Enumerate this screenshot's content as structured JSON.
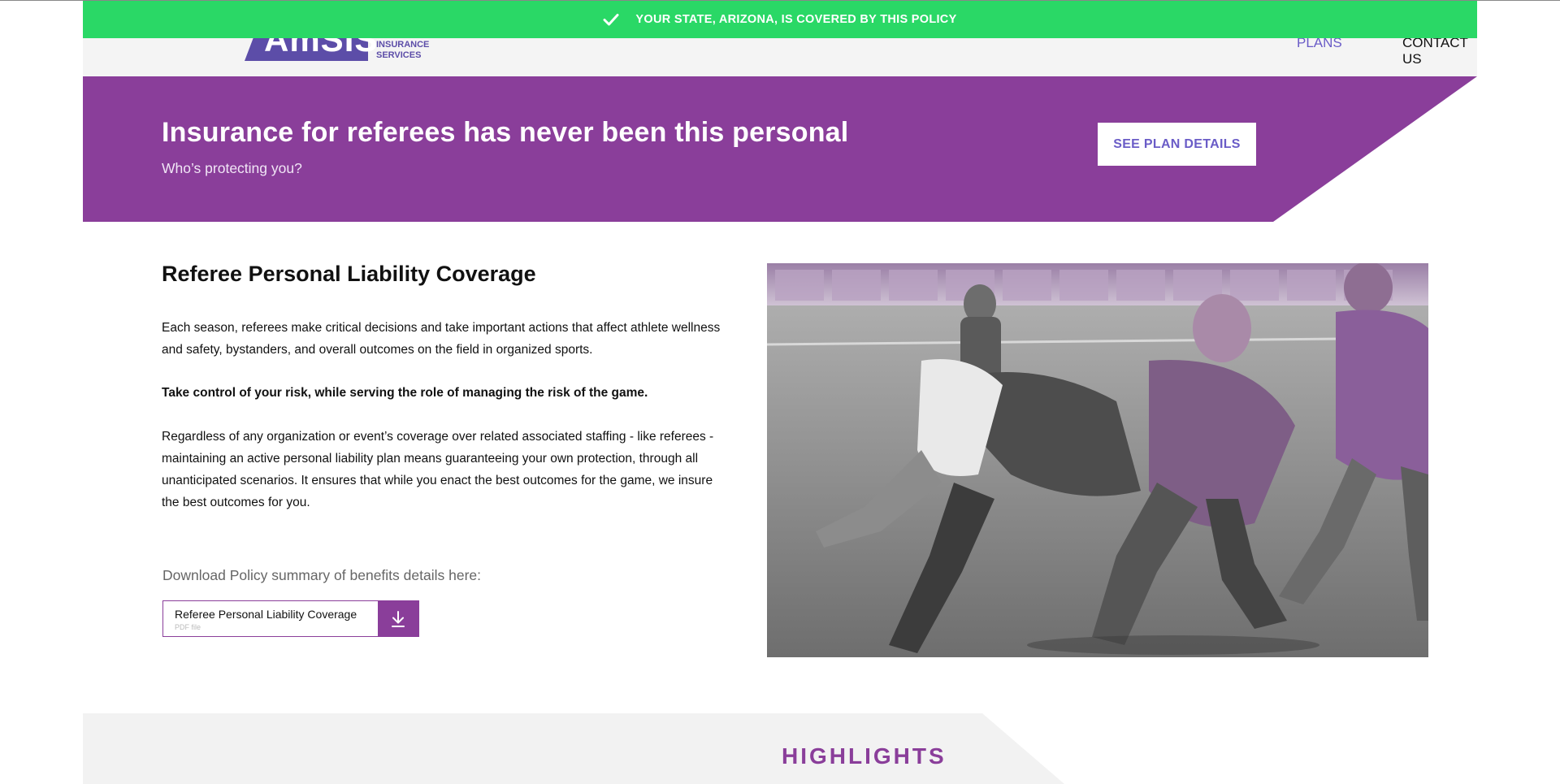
{
  "banner": {
    "text": "YOUR STATE, ARIZONA, IS COVERED BY THIS POLICY",
    "icon": "check-icon",
    "color": "#2ad866"
  },
  "header": {
    "logo": {
      "mark_text": "AmSIS",
      "sub_line_1": "INSURANCE",
      "sub_line_2": "SERVICES"
    },
    "nav": [
      {
        "label": "PLANS"
      },
      {
        "label": "CONTACT US"
      }
    ]
  },
  "hero": {
    "title": "Insurance for referees has never been this personal",
    "subtitle": "Who’s protecting you?",
    "button_label": "SEE PLAN DETAILS",
    "color": "#8a3e9a"
  },
  "main": {
    "title": "Referee Personal Liability Coverage",
    "paragraph_1": "Each season, referees make critical decisions and take important actions that affect athlete wellness and safety, bystanders, and overall outcomes on the field in organized sports.",
    "paragraph_2": "Take control of your risk, while serving the role of managing the risk of the game.",
    "paragraph_3": "Regardless of any organization or event’s coverage over related associated staffing - like referees - maintaining an active personal liability plan means guaranteeing your own protection, through all unanticipated scenarios. It ensures that while you enact the best outcomes for the game, we insure the best outcomes for you.",
    "download_label": "Download Policy summary of benefits details here:",
    "download": {
      "file_name": "Referee Personal Liability Coverage",
      "file_type": "PDF file",
      "icon": "download-icon"
    }
  },
  "highlights": {
    "title": "HIGHLIGHTS"
  }
}
